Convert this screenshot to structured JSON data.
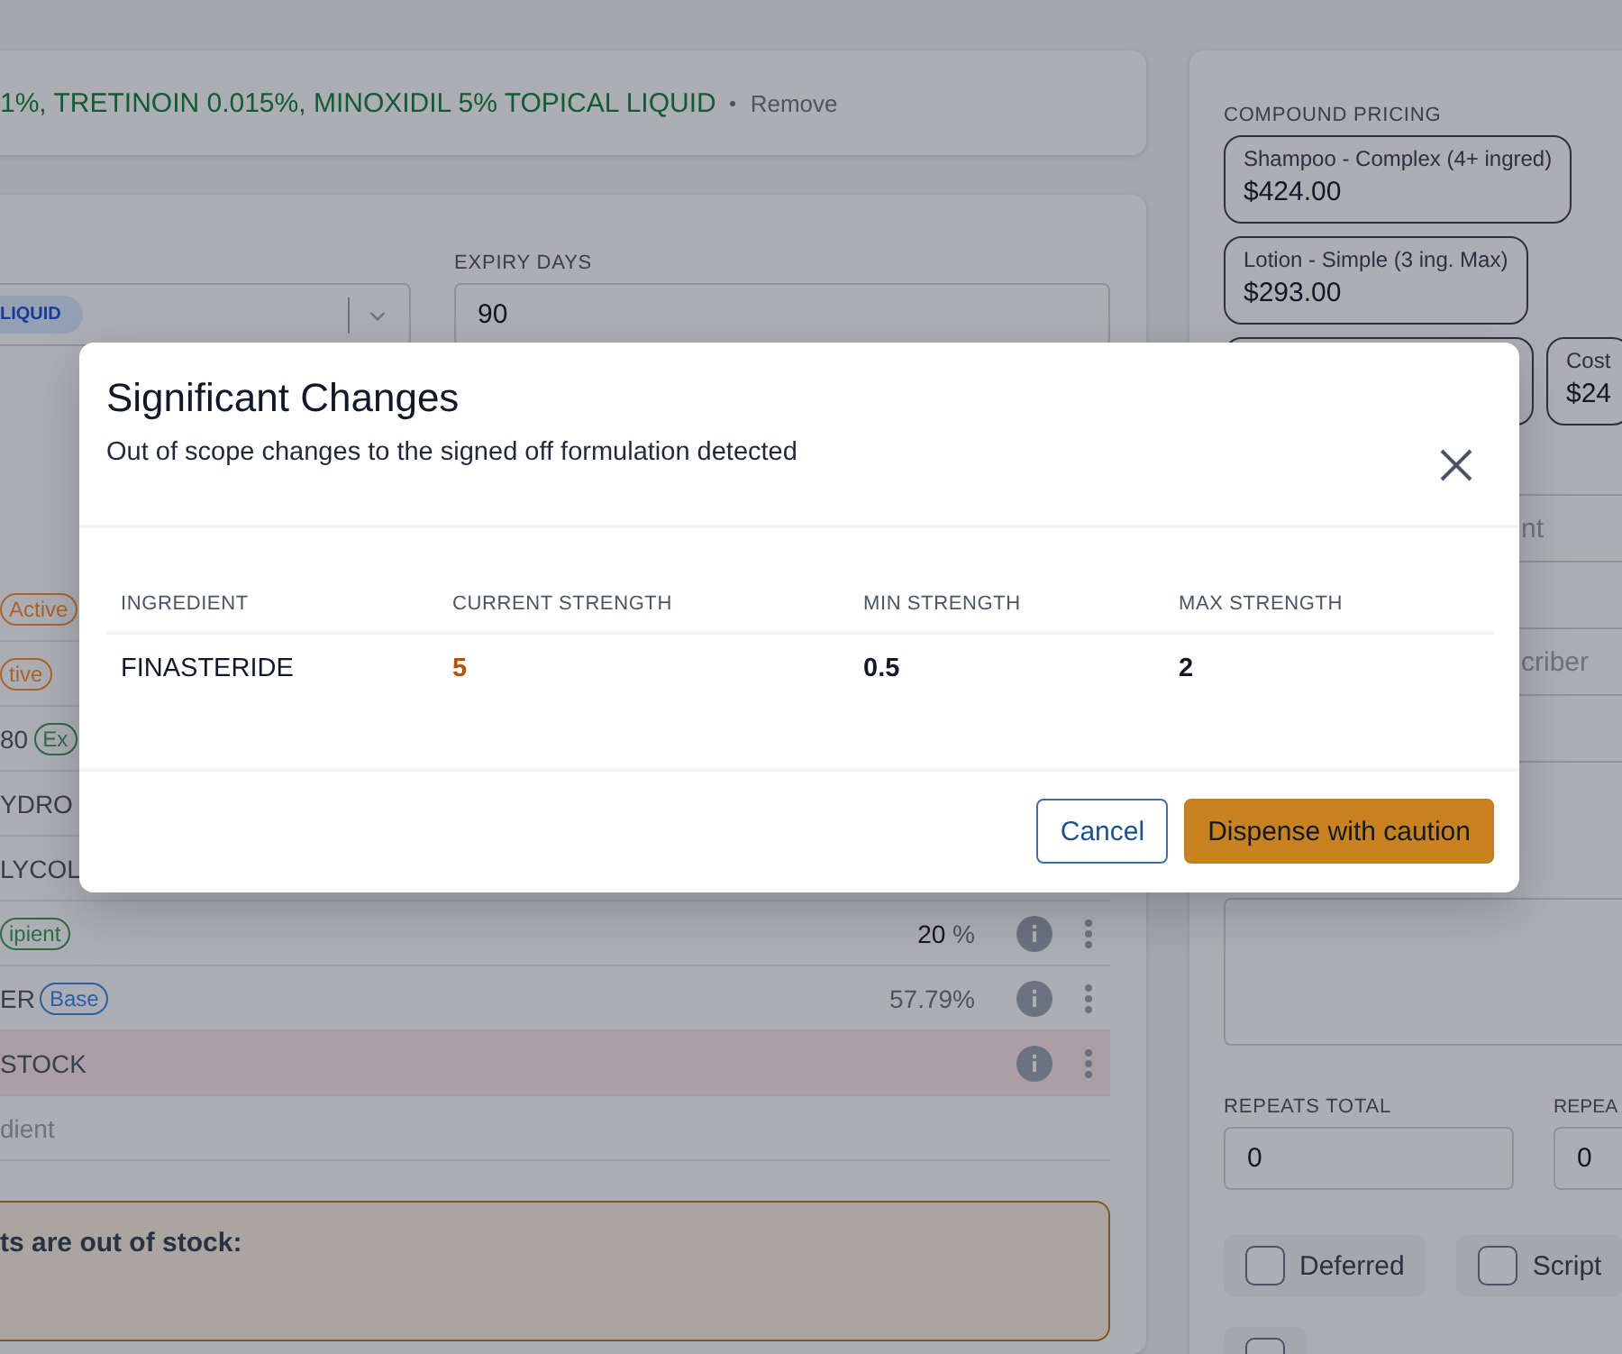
{
  "formulation": {
    "name": "1%, TRETINOIN 0.015%, MINOXIDIL 5% TOPICAL LIQUID",
    "action": "Remove"
  },
  "form_select": {
    "chip": "LIQUID"
  },
  "expiry_days": {
    "label": "EXPIRY DAYS",
    "value": "90"
  },
  "ingredients": [
    {
      "kind": "ingredient",
      "tag": "Active",
      "color": "#a8652f"
    },
    {
      "kind": "ingredient",
      "tag": "tive",
      "color": "#a8652f"
    },
    {
      "kind": "ingredient",
      "name": "80",
      "tag": "Ex",
      "color": "#2f6b4a"
    },
    {
      "kind": "ingredient",
      "name": "YDRO"
    },
    {
      "kind": "ingredient",
      "name": "LYCOL"
    },
    {
      "kind": "ingredient",
      "tag": "ipient",
      "color": "#2f6b4a",
      "strength": "20",
      "unit": "%"
    },
    {
      "kind": "ingredient",
      "name": "ER",
      "tag": "Base",
      "color": "#2d5ea8",
      "strength": "57.79%",
      "computed": true
    },
    {
      "kind": "ingredient",
      "name": "STOCK",
      "out_of_stock": true
    },
    {
      "kind": "add",
      "name": "dient"
    }
  ],
  "stock_warning": {
    "text": "ts are out of stock:"
  },
  "compound_pricing": {
    "label": "COMPOUND PRICING",
    "options": [
      {
        "kind": "option",
        "name": "Shampoo - Complex (4+ ingred)",
        "price": "$424.00"
      },
      {
        "kind": "option",
        "name": "Lotion - Simple (3 ing. Max)",
        "price": "$293.00"
      },
      {
        "kind": "covered"
      },
      {
        "kind": "option",
        "name": "Cost",
        "price": "$24"
      }
    ]
  },
  "side_fields": [
    {
      "kind": "field",
      "placeholder": "nt"
    },
    {
      "kind": "field"
    },
    {
      "kind": "field",
      "placeholder": "criber"
    },
    {
      "kind": "field"
    },
    {
      "kind": "field"
    }
  ],
  "repeats": [
    {
      "label": "REPEATS TOTAL",
      "value": "0"
    },
    {
      "label": "REPEA",
      "value": "0"
    }
  ],
  "options": [
    {
      "label": "Deferred",
      "checked": false
    },
    {
      "label": "Script",
      "checked": false
    },
    {
      "checked": false
    }
  ],
  "dialog": {
    "title": "Significant Changes",
    "subtitle": "Out of scope changes to the signed off formulation detected",
    "columns": [
      "INGREDIENT",
      "CURRENT STRENGTH",
      "MIN STRENGTH",
      "MAX STRENGTH"
    ],
    "rows": [
      {
        "ingredient": "FINASTERIDE",
        "current_strength": "5",
        "current_out_of_range": true,
        "min_strength": "0.5",
        "max_strength": "2"
      }
    ],
    "buttons": [
      {
        "kind": "secondary",
        "label": "Cancel"
      },
      {
        "kind": "primary",
        "label": "Dispense with caution"
      }
    ]
  }
}
